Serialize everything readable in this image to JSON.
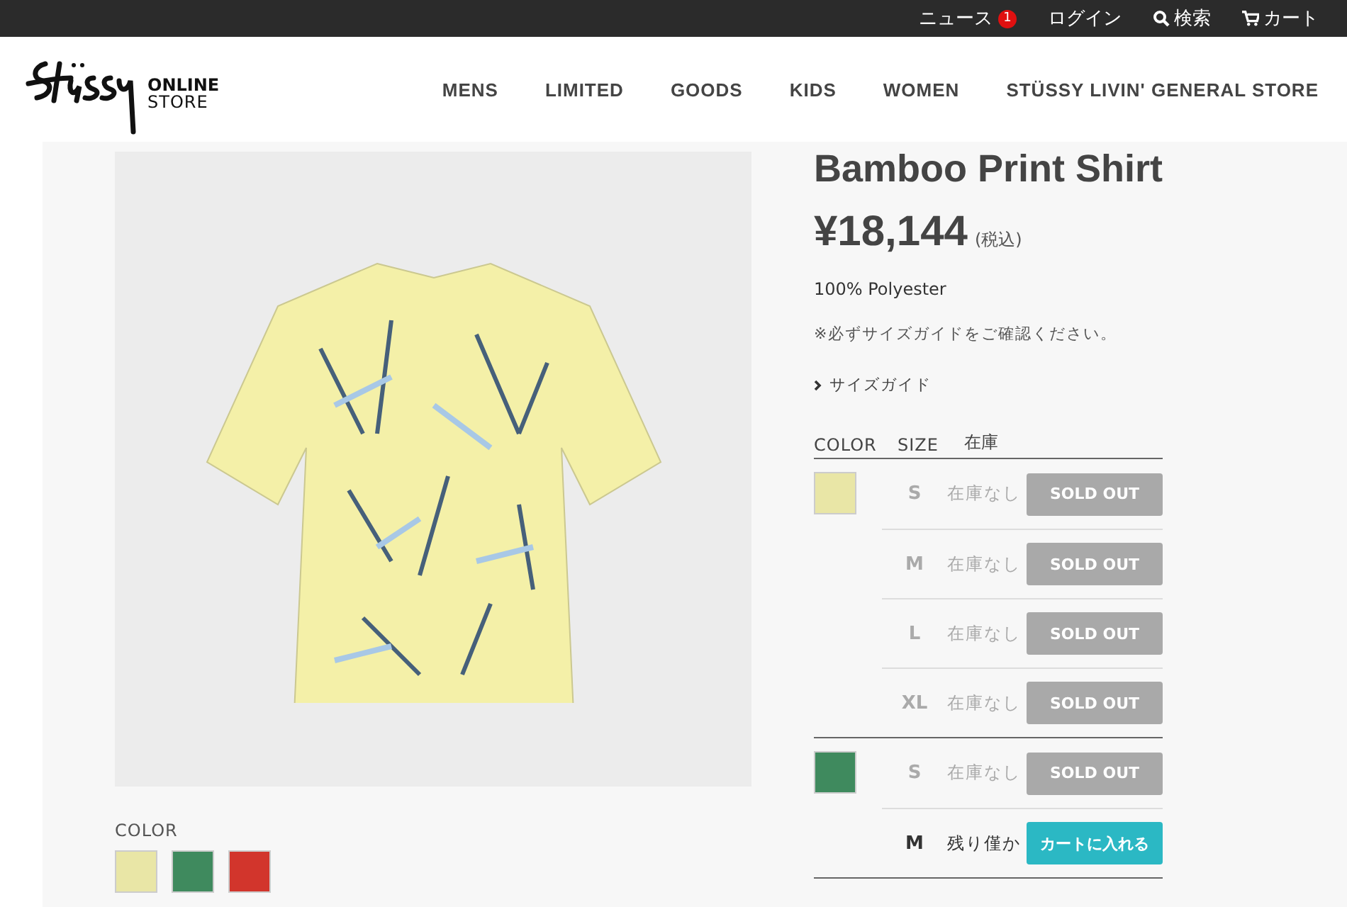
{
  "topbar": {
    "news": {
      "label": "ニュース",
      "badge": "1"
    },
    "login": "ログイン",
    "search": "検索",
    "cart": "カート"
  },
  "header": {
    "store_label": [
      "ONLINE",
      "STORE"
    ],
    "nav": [
      "MENS",
      "LIMITED",
      "GOODS",
      "KIDS",
      "WOMEN",
      "STÜSSY LIVIN' GENERAL STORE"
    ]
  },
  "product": {
    "title": "Bamboo Print Shirt",
    "price": "¥18,144",
    "tax": "(税込)",
    "material": "100% Polyester",
    "note": "※必ずサイズガイドをご確認ください。",
    "size_guide": "サイズガイド",
    "color_label": "COLOR",
    "colors": [
      {
        "color": "#e9e6a6",
        "selected": false
      },
      {
        "color": "#3f8a5e",
        "selected": false
      },
      {
        "color": "#d2352c",
        "selected": false
      }
    ],
    "stock_table": {
      "columns": [
        "COLOR",
        "SIZE",
        "在庫"
      ],
      "groups": [
        {
          "color": "#e9e6a6",
          "rows": [
            {
              "size": "S",
              "stock": "在庫なし",
              "available": false,
              "button": "SOLD OUT"
            },
            {
              "size": "M",
              "stock": "在庫なし",
              "available": false,
              "button": "SOLD OUT"
            },
            {
              "size": "L",
              "stock": "在庫なし",
              "available": false,
              "button": "SOLD OUT"
            },
            {
              "size": "XL",
              "stock": "在庫なし",
              "available": false,
              "button": "SOLD OUT"
            }
          ]
        },
        {
          "color": "#3f8a5e",
          "rows": [
            {
              "size": "S",
              "stock": "在庫なし",
              "available": false,
              "button": "SOLD OUT"
            },
            {
              "size": "M",
              "stock": "残り僅か",
              "available": true,
              "button": "カートに入れる"
            }
          ]
        }
      ]
    }
  }
}
